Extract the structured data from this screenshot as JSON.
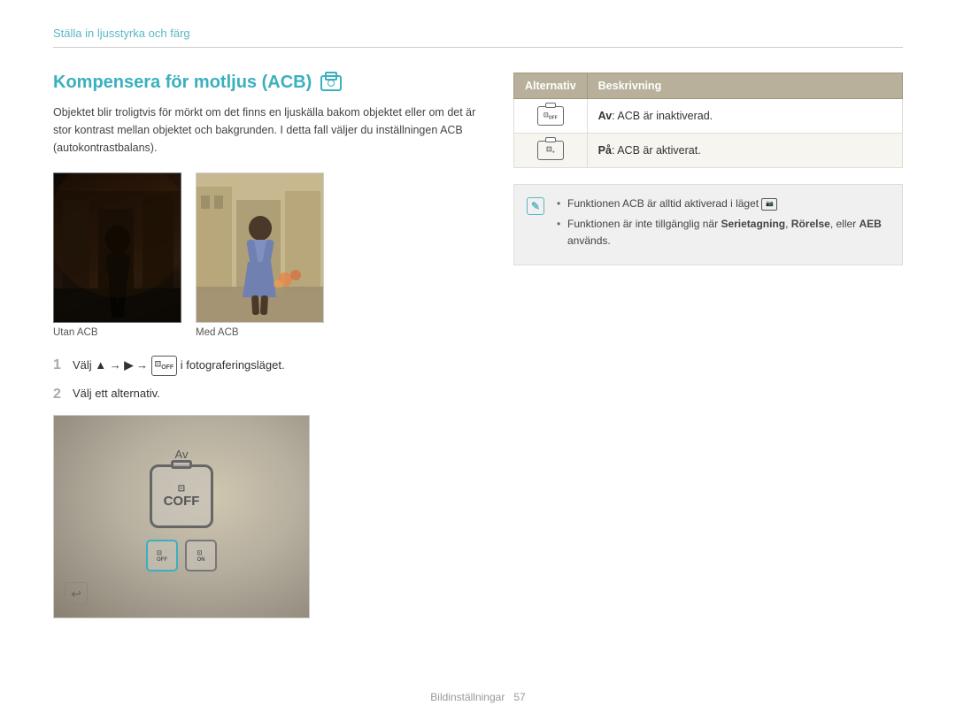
{
  "breadcrumb": {
    "text": "Ställa in ljusstyrka och färg"
  },
  "section": {
    "title": "Kompensera för motljus (ACB)",
    "description": "Objektet blir troligtvis för mörkt om det finns en ljuskälla bakom objektet eller om det är stor kontrast mellan objektet och bakgrunden. I detta fall väljer du inställningen ACB (autokontrastbalans).",
    "photo_without_label": "Utan ACB",
    "photo_with_label": "Med ACB"
  },
  "steps": [
    {
      "number": "1",
      "text_before": "Välj",
      "nav": "▲ → ▶ →",
      "icon_label": "OFF",
      "text_after": "i fotograferingsläget."
    },
    {
      "number": "2",
      "text": "Välj ett alternativ."
    }
  ],
  "table": {
    "col1": "Alternativ",
    "col2": "Beskrivning",
    "rows": [
      {
        "icon_text": "OFF",
        "description_bold": "Av",
        "description_rest": ": ACB är inaktiverad."
      },
      {
        "icon_text": "ON",
        "description_bold": "På",
        "description_rest": ": ACB är aktiverat."
      }
    ]
  },
  "notes": {
    "items": [
      "Funktionen ACB är alltid aktiverad i läget",
      "Funktionen är inte tillgänglig när Serietagning, Rörelse, eller AEB används."
    ],
    "bold_words": [
      "Serietagning,",
      "Rörelse,",
      "AEB"
    ]
  },
  "screenshot": {
    "label": "Av",
    "icon_text": "COFF",
    "small_icon1": "OFF",
    "small_icon2": "ON"
  },
  "footer": {
    "text": "Bildinställningar",
    "page": "57"
  }
}
